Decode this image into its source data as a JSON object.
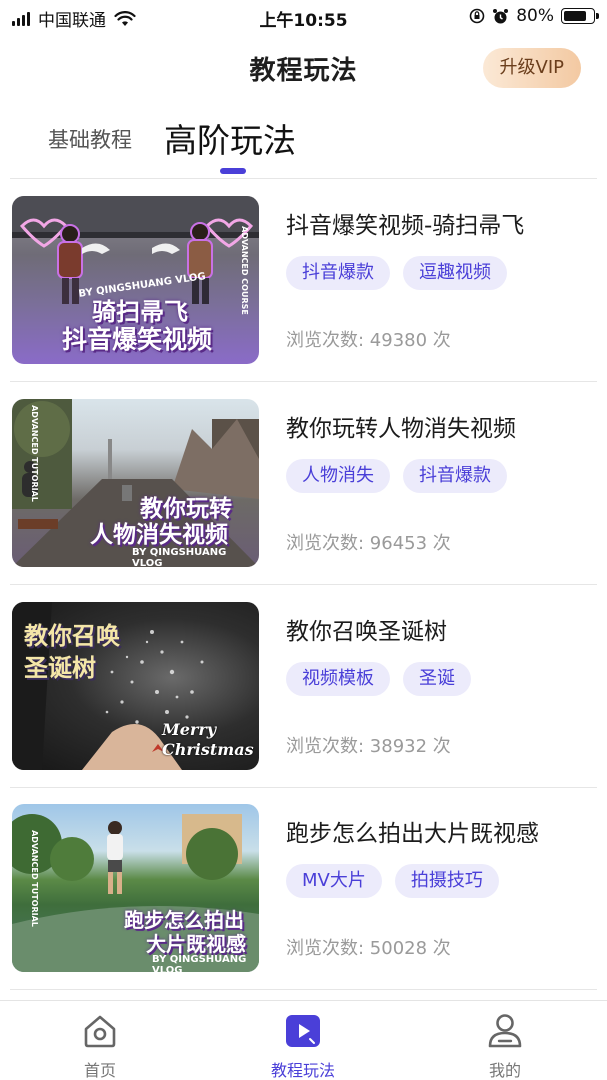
{
  "status_bar": {
    "carrier": "中国联通",
    "time": "上午10:55",
    "battery": "80%",
    "battery_level": 0.8,
    "icons": [
      "signal-icon",
      "wifi-icon",
      "orientation-lock-icon",
      "alarm-icon",
      "battery-icon"
    ]
  },
  "header": {
    "title": "教程玩法",
    "vip_label": "升级VIP"
  },
  "tabs": {
    "basic": "基础教程",
    "advanced": "高阶玩法",
    "active": "advanced"
  },
  "tutorials": [
    {
      "title": "抖音爆笑视频-骑扫帚飞",
      "tags": [
        "抖音爆款",
        "逗趣视频"
      ],
      "views": "浏览次数: 49380 次",
      "thumb_lines": [
        "骑扫帚飞",
        "抖音爆笑视频"
      ],
      "thumb_sub": "BY QINGSHUANG VLOG",
      "thumb_side": "ADVANCED COURSE"
    },
    {
      "title": "教你玩转人物消失视频",
      "tags": [
        "人物消失",
        "抖音爆款"
      ],
      "views": "浏览次数: 96453 次",
      "thumb_lines": [
        "教你玩转",
        "人物消失视频"
      ],
      "thumb_sub": "BY QINGSHUANG VLOG",
      "thumb_side": "ADVANCED TUTORIAL"
    },
    {
      "title": "教你召唤圣诞树",
      "tags": [
        "视频模板",
        "圣诞"
      ],
      "views": "浏览次数: 38932 次",
      "thumb_lines": [
        "教你召唤",
        "圣诞树"
      ],
      "thumb_sub": "Merry Christmas",
      "thumb_side": ""
    },
    {
      "title": "跑步怎么拍出大片既视感",
      "tags": [
        "MV大片",
        "拍摄技巧"
      ],
      "views": "浏览次数: 50028 次",
      "thumb_lines": [
        "跑步怎么拍出",
        "大片既视感"
      ],
      "thumb_sub": "BY QINGSHUANG VLOG",
      "thumb_side": "ADVANCED TUTORIAL"
    }
  ],
  "bottom_nav": [
    {
      "label": "首页",
      "icon": "home-icon",
      "active": false
    },
    {
      "label": "教程玩法",
      "icon": "play-icon",
      "active": true
    },
    {
      "label": "我的",
      "icon": "profile-icon",
      "active": false
    }
  ],
  "colors": {
    "accent": "#4a3fd8",
    "tag_bg": "#ecebfb",
    "vip_gradient_start": "#fbe9d6",
    "vip_gradient_end": "#f3c9a2"
  }
}
